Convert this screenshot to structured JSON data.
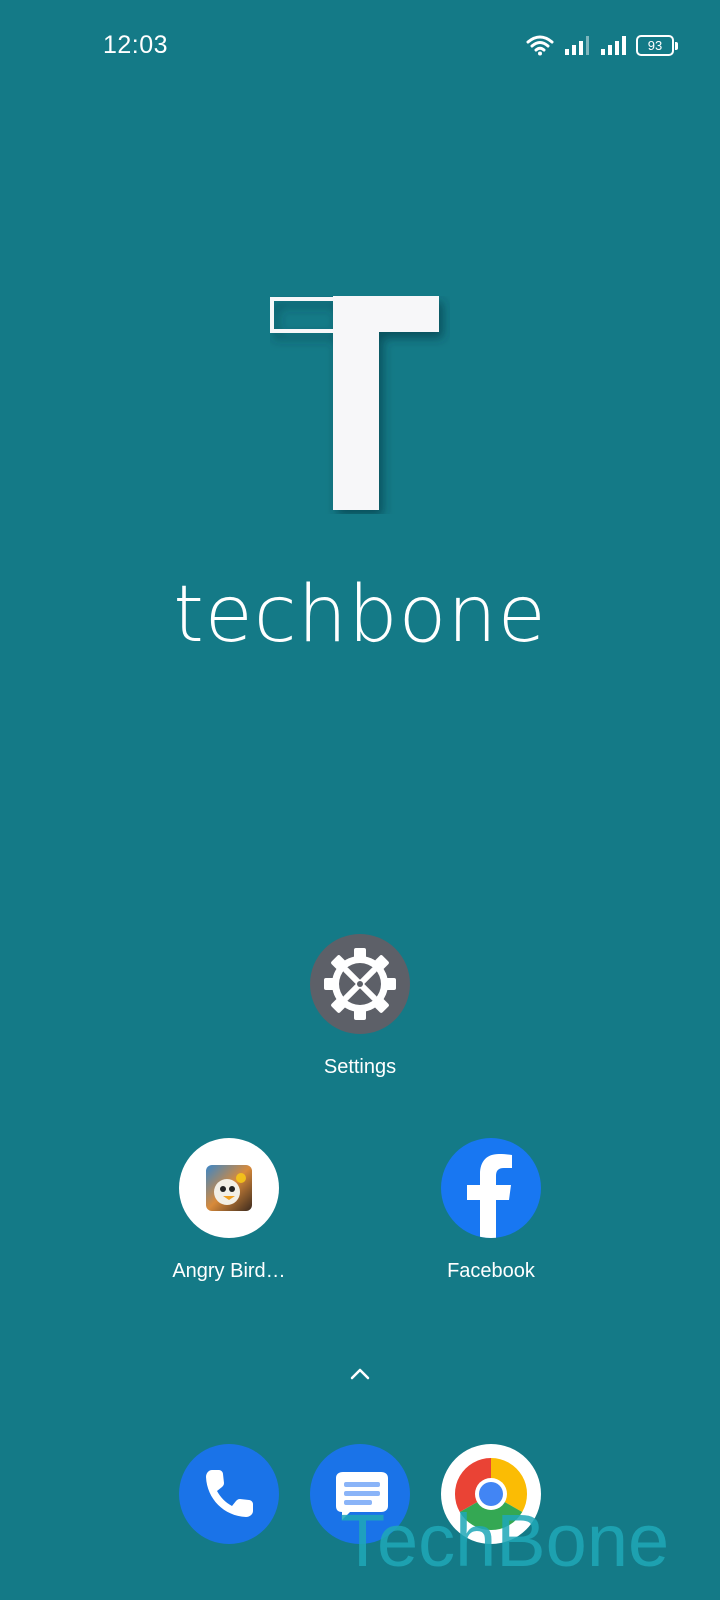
{
  "status_bar": {
    "time": "12:03",
    "battery_percent": "93",
    "icons": [
      "wifi-icon",
      "signal-icon",
      "signal-icon",
      "battery-icon"
    ]
  },
  "wallpaper": {
    "brand": "techbone"
  },
  "home_apps": [
    {
      "label": "Settings",
      "icon": "settings-icon"
    },
    {
      "label": "Angry Bird…",
      "icon": "angry-birds-icon"
    },
    {
      "label": "Facebook",
      "icon": "facebook-icon"
    }
  ],
  "drawer_handle": {
    "icon": "chevron-up-icon"
  },
  "dock": [
    {
      "icon": "phone-icon"
    },
    {
      "icon": "messages-icon"
    },
    {
      "icon": "chrome-icon"
    }
  ],
  "watermark": "TechBone",
  "colors": {
    "background": "#147a87",
    "settings": "#5d6068",
    "facebook": "#1877f2",
    "dock_blue": "#1a73e8",
    "watermark": "#1fa8b8"
  }
}
